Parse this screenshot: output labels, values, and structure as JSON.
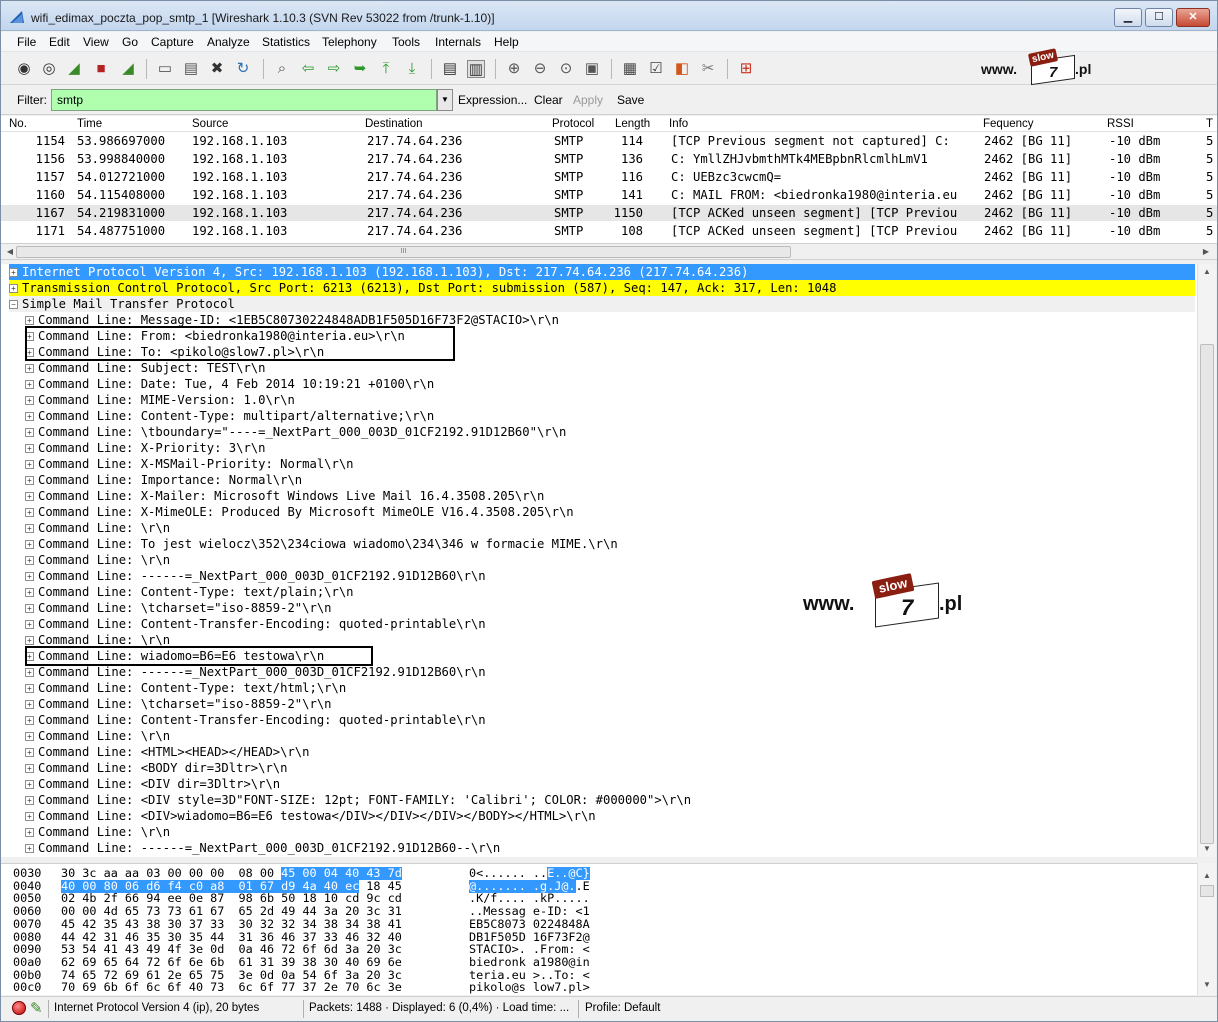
{
  "window": {
    "title": "wifi_edimax_poczta_pop_smtp_1  [Wireshark 1.10.3  (SVN Rev 53022 from /trunk-1.10)]",
    "min_label": "▁",
    "max_label": "☐",
    "close_label": "✕"
  },
  "menu": [
    "File",
    "Edit",
    "View",
    "Go",
    "Capture",
    "Analyze",
    "Statistics",
    "Telephony",
    "Tools",
    "Internals",
    "Help"
  ],
  "toolbar": {
    "icons": [
      "interface-list-icon",
      "capture-options-icon",
      "start-capture-icon",
      "stop-capture-icon",
      "restart-capture-icon",
      "open-file-icon",
      "save-file-icon",
      "close-file-icon",
      "reload-icon",
      "find-packet-icon",
      "go-back-icon",
      "go-forward-icon",
      "go-to-packet-icon",
      "go-first-icon",
      "go-last-icon",
      "colorize-icon",
      "auto-scroll-icon",
      "zoom-in-icon",
      "zoom-out-icon",
      "normal-size-icon",
      "resize-columns-icon",
      "capture-filters-icon",
      "display-filters-icon",
      "coloring-rules-icon",
      "preferences-icon",
      "help-icon"
    ]
  },
  "logo": {
    "www": "www.",
    "slow": "slow",
    "seven": "7",
    "pl": ".pl"
  },
  "filter": {
    "label": "Filter:",
    "value": "smtp",
    "expression": "Expression...",
    "clear": "Clear",
    "apply": "Apply",
    "save": "Save"
  },
  "packet_list": {
    "columns": [
      "No.",
      "Time",
      "Source",
      "Destination",
      "Protocol",
      "Length",
      "Info",
      "Fequency",
      "RSSI",
      "T"
    ],
    "rows": [
      {
        "no": "1154",
        "time": "53.986697000",
        "src": "192.168.1.103",
        "dst": "217.74.64.236",
        "proto": "SMTP",
        "len": "114",
        "info": "[TCP Previous segment not captured] C:",
        "freq": "2462 [BG 11]",
        "rssi": "-10 dBm",
        "t": "5"
      },
      {
        "no": "1156",
        "time": "53.998840000",
        "src": "192.168.1.103",
        "dst": "217.74.64.236",
        "proto": "SMTP",
        "len": "136",
        "info": "C: YmllZHJvbmthMTk4MEBpbnRlcmlhLmV1",
        "freq": "2462 [BG 11]",
        "rssi": "-10 dBm",
        "t": "5"
      },
      {
        "no": "1157",
        "time": "54.012721000",
        "src": "192.168.1.103",
        "dst": "217.74.64.236",
        "proto": "SMTP",
        "len": "116",
        "info": "C: UEBzc3cwcmQ=",
        "freq": "2462 [BG 11]",
        "rssi": "-10 dBm",
        "t": "5"
      },
      {
        "no": "1160",
        "time": "54.115408000",
        "src": "192.168.1.103",
        "dst": "217.74.64.236",
        "proto": "SMTP",
        "len": "141",
        "info": "C: MAIL FROM: <biedronka1980@interia.eu",
        "freq": "2462 [BG 11]",
        "rssi": "-10 dBm",
        "t": "5"
      },
      {
        "no": "1167",
        "time": "54.219831000",
        "src": "192.168.1.103",
        "dst": "217.74.64.236",
        "proto": "SMTP",
        "len": "1150",
        "info": "[TCP ACKed unseen segment] [TCP Previou",
        "freq": "2462 [BG 11]",
        "rssi": "-10 dBm",
        "t": "5"
      },
      {
        "no": "1171",
        "time": "54.487751000",
        "src": "192.168.1.103",
        "dst": "217.74.64.236",
        "proto": "SMTP",
        "len": "108",
        "info": "[TCP ACKed unseen segment] [TCP Previou",
        "freq": "2462 [BG 11]",
        "rssi": "-10 dBm",
        "t": "5"
      }
    ],
    "selected_row": 4,
    "hscroll_grip": "III"
  },
  "details": {
    "ip": "Internet Protocol Version 4, Src: 192.168.1.103 (192.168.1.103), Dst: 217.74.64.236 (217.74.64.236)",
    "tcp": "Transmission Control Protocol, Src Port: 6213 (6213), Dst Port: submission (587), Seq: 147, Ack: 317, Len: 1048",
    "smtp": "Simple Mail Transfer Protocol",
    "lines": [
      "Command Line: Message-ID: <1EB5C80730224848ADB1F505D16F73F2@STACIO>\\r\\n",
      "Command Line: From: <biedronka1980@interia.eu>\\r\\n",
      "Command Line: To: <pikolo@slow7.pl>\\r\\n",
      "Command Line: Subject: TEST\\r\\n",
      "Command Line: Date: Tue, 4 Feb 2014 10:19:21 +0100\\r\\n",
      "Command Line: MIME-Version: 1.0\\r\\n",
      "Command Line: Content-Type: multipart/alternative;\\r\\n",
      "Command Line: \\tboundary=\"----=_NextPart_000_003D_01CF2192.91D12B60\"\\r\\n",
      "Command Line: X-Priority: 3\\r\\n",
      "Command Line: X-MSMail-Priority: Normal\\r\\n",
      "Command Line: Importance: Normal\\r\\n",
      "Command Line: X-Mailer: Microsoft Windows Live Mail 16.4.3508.205\\r\\n",
      "Command Line: X-MimeOLE: Produced By Microsoft MimeOLE V16.4.3508.205\\r\\n",
      "Command Line: \\r\\n",
      "Command Line: To jest wielocz\\352\\234ciowa wiadomo\\234\\346 w formacie MIME.\\r\\n",
      "Command Line: \\r\\n",
      "Command Line: ------=_NextPart_000_003D_01CF2192.91D12B60\\r\\n",
      "Command Line: Content-Type: text/plain;\\r\\n",
      "Command Line: \\tcharset=\"iso-8859-2\"\\r\\n",
      "Command Line: Content-Transfer-Encoding: quoted-printable\\r\\n",
      "Command Line: \\r\\n",
      "Command Line: wiadomo=B6=E6 testowa\\r\\n",
      "Command Line: ------=_NextPart_000_003D_01CF2192.91D12B60\\r\\n",
      "Command Line: Content-Type: text/html;\\r\\n",
      "Command Line: \\tcharset=\"iso-8859-2\"\\r\\n",
      "Command Line: Content-Transfer-Encoding: quoted-printable\\r\\n",
      "Command Line: \\r\\n",
      "Command Line: <HTML><HEAD></HEAD>\\r\\n",
      "Command Line: <BODY dir=3Dltr>\\r\\n",
      "Command Line: <DIV dir=3Dltr>\\r\\n",
      "Command Line: <DIV style=3D\"FONT-SIZE: 12pt; FONT-FAMILY: 'Calibri'; COLOR: #000000\">\\r\\n",
      "Command Line: <DIV>wiadomo=B6=E6 testowa</DIV></DIV></DIV></BODY></HTML>\\r\\n",
      "Command Line: \\r\\n",
      "Command Line: ------=_NextPart_000_003D_01CF2192.91D12B60--\\r\\n"
    ]
  },
  "bytes": [
    {
      "off": "0030",
      "hex": "30 3c aa aa 03 00 00 00  08 00 ",
      "hex_sel": "45 00 04 40 43 7d",
      "hex_rest": "",
      "asc": "0<...... ..",
      "asc_sel": "E..@C}",
      "asc_rest": ""
    },
    {
      "off": "0040",
      "hex": "",
      "hex_sel": "40 00 80 06 d6 f4 c0 a8  01 67 d9 4a 40 ec",
      "hex_rest": " 18 45",
      "asc": "",
      "asc_sel": "@....... .g.J@.",
      "asc_rest": ".E"
    },
    {
      "off": "0050",
      "hex": "02 4b 2f 66 94 ee 0e 87  98 6b 50 18 10 cd 9c cd",
      "hex_sel": "",
      "hex_rest": "",
      "asc": ".K/f.... .kP.....",
      "asc_sel": "",
      "asc_rest": ""
    },
    {
      "off": "0060",
      "hex": "00 00 4d 65 73 73 61 67  65 2d 49 44 3a 20 3c 31",
      "hex_sel": "",
      "hex_rest": "",
      "asc": "..Messag e-ID: <1",
      "asc_sel": "",
      "asc_rest": ""
    },
    {
      "off": "0070",
      "hex": "45 42 35 43 38 30 37 33  30 32 32 34 38 34 38 41",
      "hex_sel": "",
      "hex_rest": "",
      "asc": "EB5C8073 0224848A",
      "asc_sel": "",
      "asc_rest": ""
    },
    {
      "off": "0080",
      "hex": "44 42 31 46 35 30 35 44  31 36 46 37 33 46 32 40",
      "hex_sel": "",
      "hex_rest": "",
      "asc": "DB1F505D 16F73F2@",
      "asc_sel": "",
      "asc_rest": ""
    },
    {
      "off": "0090",
      "hex": "53 54 41 43 49 4f 3e 0d  0a 46 72 6f 6d 3a 20 3c",
      "hex_sel": "",
      "hex_rest": "",
      "asc": "STACIO>. .From: <",
      "asc_sel": "",
      "asc_rest": ""
    },
    {
      "off": "00a0",
      "hex": "62 69 65 64 72 6f 6e 6b  61 31 39 38 30 40 69 6e",
      "hex_sel": "",
      "hex_rest": "",
      "asc": "biedronk a1980@in",
      "asc_sel": "",
      "asc_rest": ""
    },
    {
      "off": "00b0",
      "hex": "74 65 72 69 61 2e 65 75  3e 0d 0a 54 6f 3a 20 3c",
      "hex_sel": "",
      "hex_rest": "",
      "asc": "teria.eu >..To: <",
      "asc_sel": "",
      "asc_rest": ""
    },
    {
      "off": "00c0",
      "hex": "70 69 6b 6f 6c 6f 40 73  6c 6f 77 37 2e 70 6c 3e",
      "hex_sel": "",
      "hex_rest": "",
      "asc": "pikolo@s low7.pl>",
      "asc_sel": "",
      "asc_rest": ""
    }
  ],
  "status": {
    "field": "Internet Protocol Version 4 (ip), 20 bytes",
    "packets": "Packets: 1488 · Displayed: 6 (0,4%) · Load time: ...",
    "profile": "Profile: Default"
  },
  "colors": {
    "selection": "#3399ff",
    "tcp_highlight": "#ffff00",
    "filter_ok": "#afffaf"
  }
}
